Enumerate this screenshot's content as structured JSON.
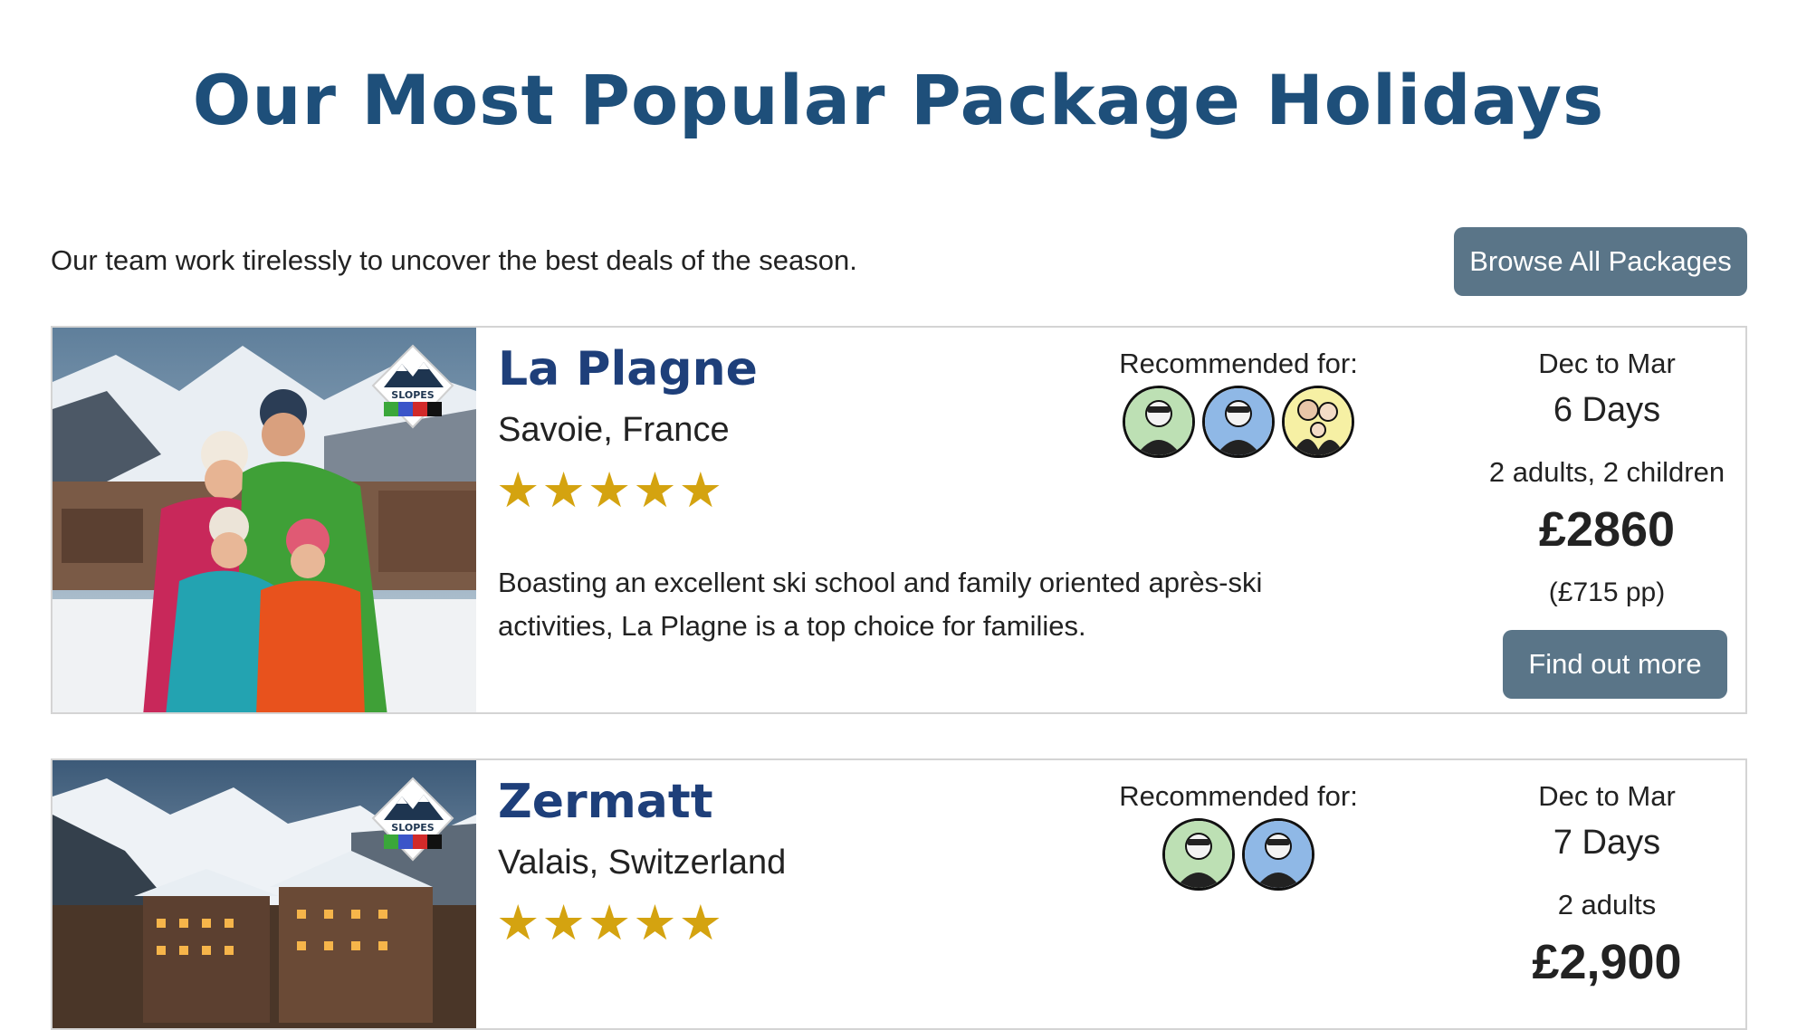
{
  "header": {
    "title": "Our Most Popular Package Holidays",
    "intro": "Our team work tirelessly to uncover the best deals of the season.",
    "browse_label": "Browse All Packages"
  },
  "packages": [
    {
      "name": "La Plagne",
      "region": "Savoie, France",
      "stars": "★★★★★",
      "rating": 5,
      "description": "Boasting an excellent ski school and family oriented après-ski activities, La Plagne is a top choice for families.",
      "recommended_label": "Recommended for:",
      "recommended_for": [
        "woman-skier-avatar",
        "woman-snowboarder-avatar",
        "family-avatar"
      ],
      "season": "Dec to Mar",
      "duration": "6 Days",
      "party": "2 adults, 2 children",
      "price": "£2860",
      "per_person": "(£715 pp)",
      "cta_label": "Find out more",
      "logo_text": "SLOPES"
    },
    {
      "name": "Zermatt",
      "region": "Valais, Switzerland",
      "stars": "★★★★★",
      "rating": 5,
      "recommended_label": "Recommended for:",
      "recommended_for": [
        "woman-skier-avatar",
        "woman-snowboarder-avatar"
      ],
      "season": "Dec to Mar",
      "duration": "7 Days",
      "party": "2 adults",
      "price": "£2,900",
      "logo_text": "SLOPES"
    }
  ],
  "colors": {
    "title": "#1e4f7a",
    "resort_name": "#1e3f7a",
    "button": "#5a7588",
    "stars": "#d4a310",
    "avatar_green": "#bde0b4",
    "avatar_blue": "#8fb8e6",
    "avatar_yellow": "#f6f0a4"
  }
}
